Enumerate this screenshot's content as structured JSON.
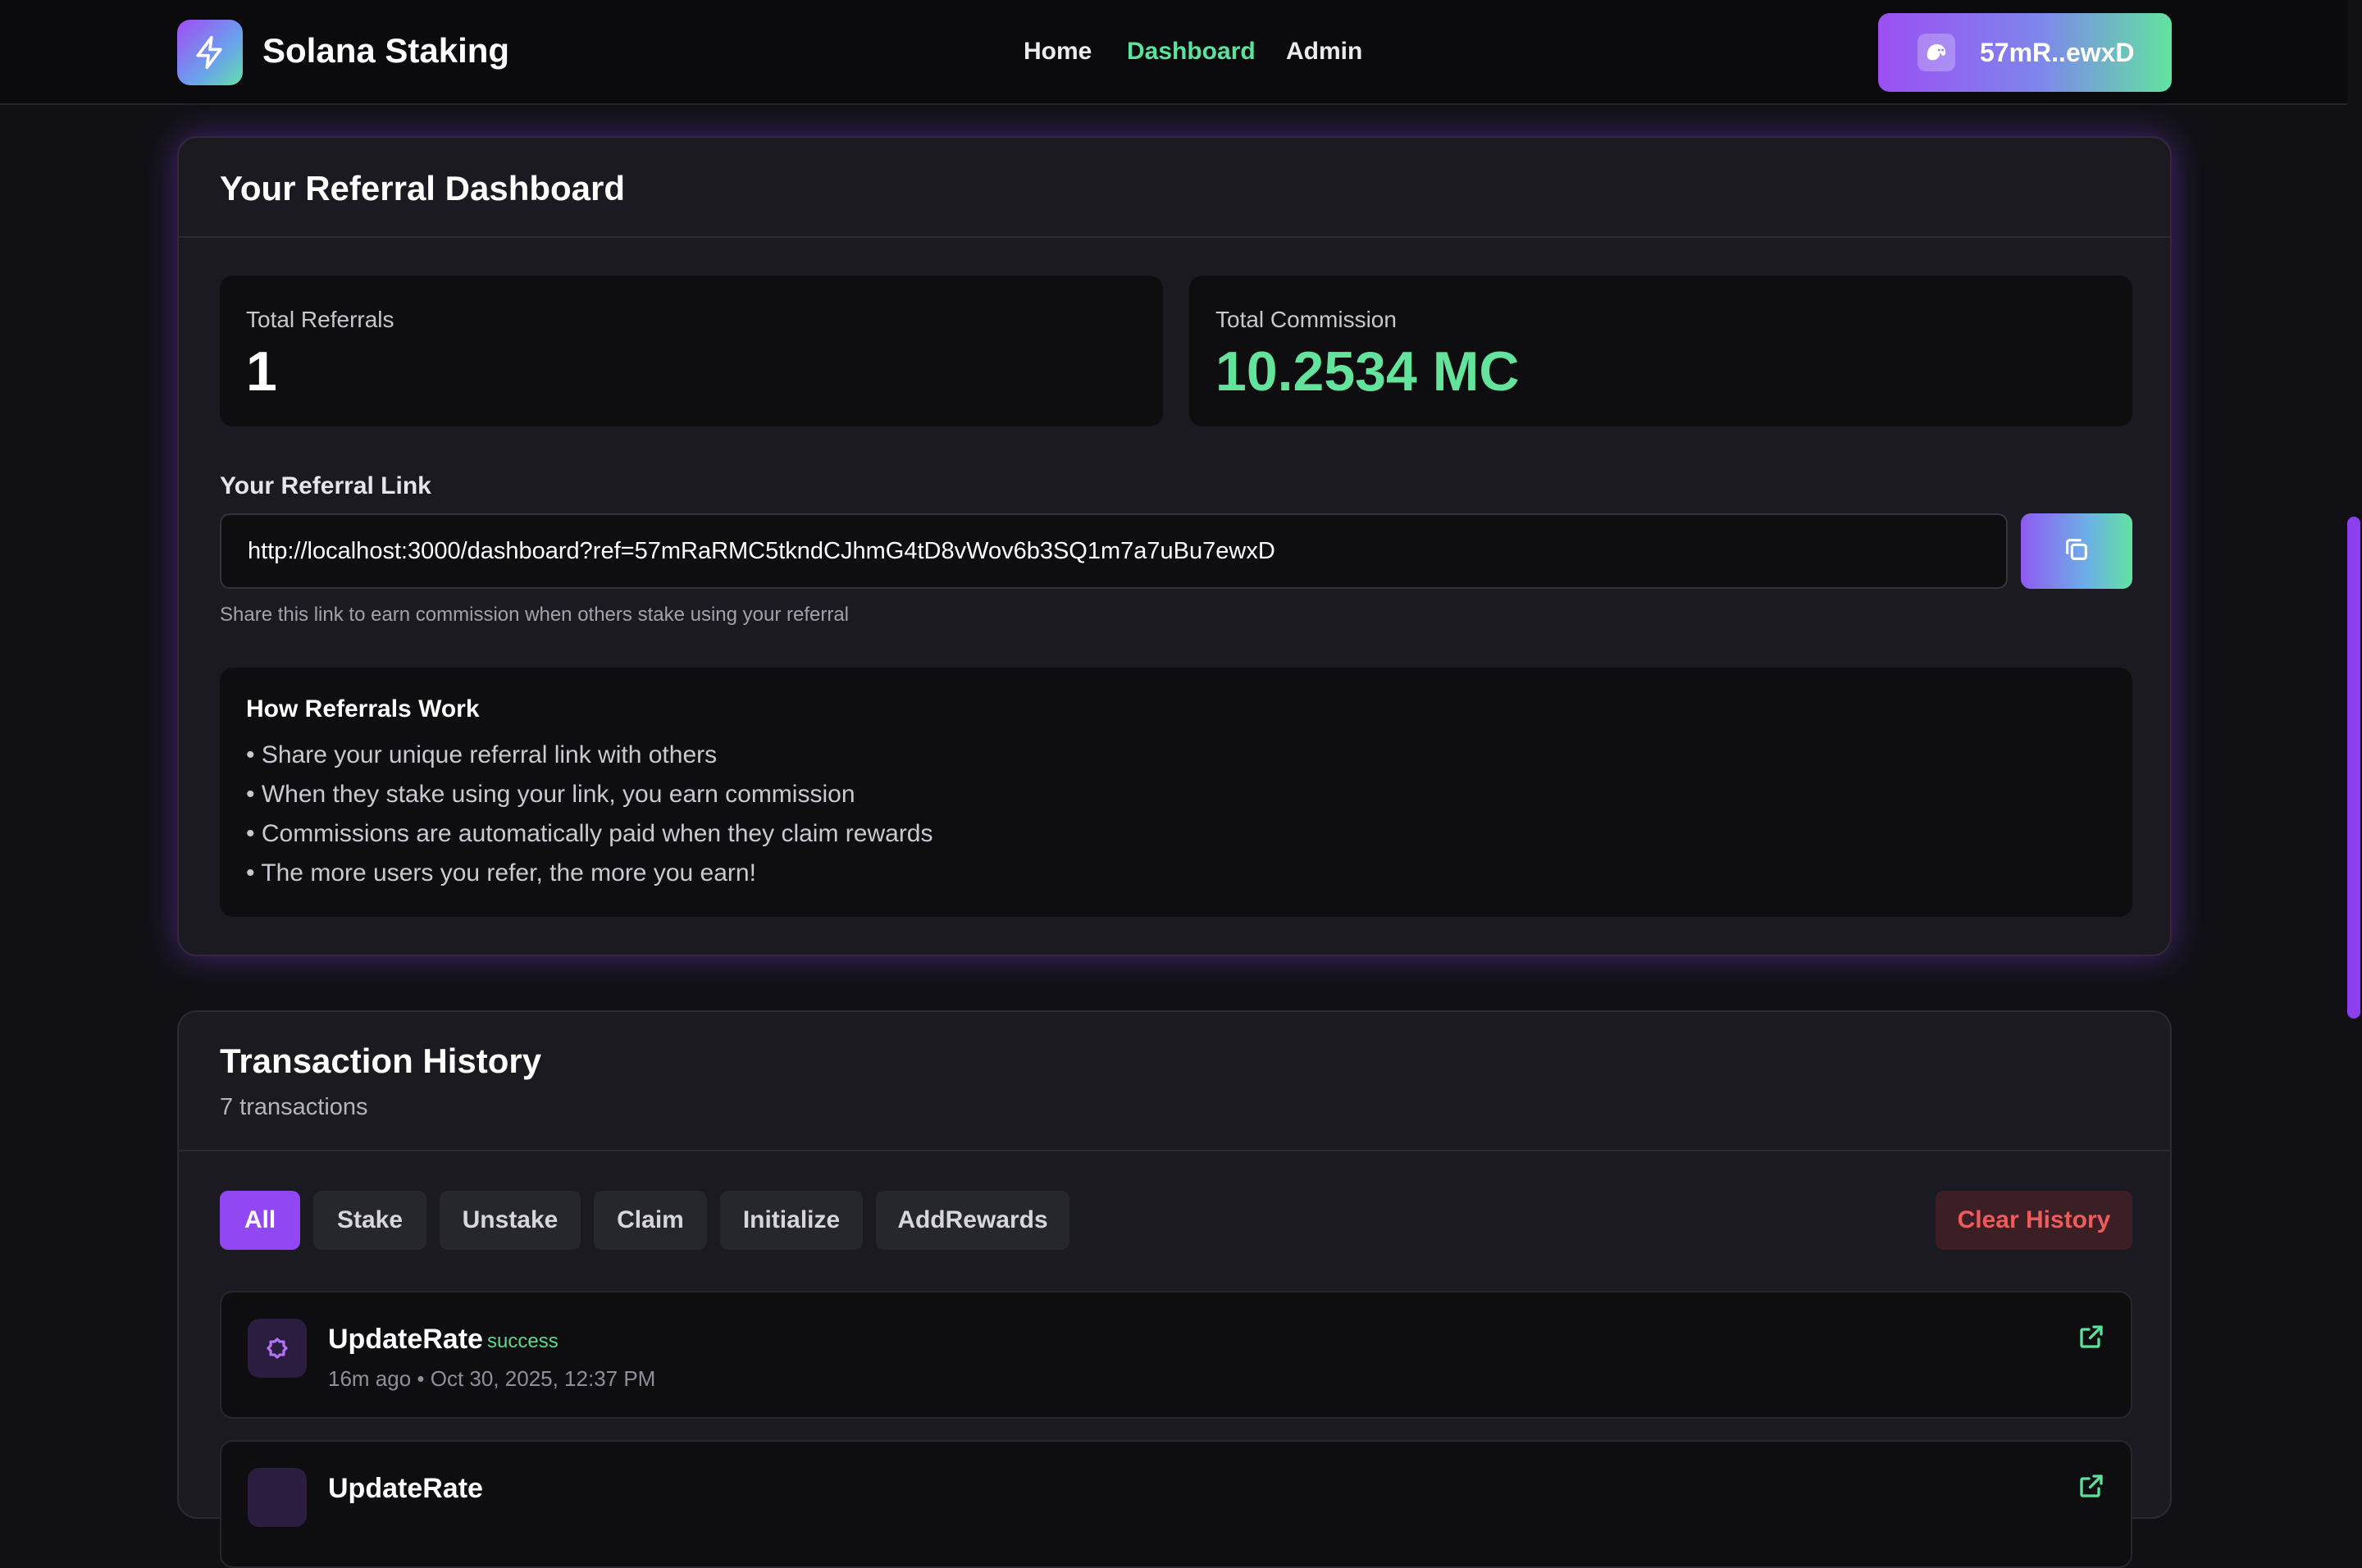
{
  "header": {
    "brand": "Solana Staking",
    "nav": [
      {
        "label": "Home",
        "active": false
      },
      {
        "label": "Dashboard",
        "active": true
      },
      {
        "label": "Admin",
        "active": false
      }
    ],
    "wallet_label": "57mR..ewxD",
    "logo_icon": "lightning-bolt-icon",
    "wallet_icon": "phantom-ghost-icon"
  },
  "referral": {
    "title": "Your Referral Dashboard",
    "total_referrals_label": "Total Referrals",
    "total_referrals_value": "1",
    "total_commission_label": "Total Commission",
    "total_commission_value": "10.2534 MC",
    "link_label": "Your Referral Link",
    "link_value": "http://localhost:3000/dashboard?ref=57mRaRMC5tkndCJhmG4tD8vWov6b3SQ1m7a7uBu7ewxD",
    "copy_icon": "copy-icon",
    "help_text": "Share this link to earn commission when others stake using your referral",
    "how_title": "How Referrals Work",
    "how_items": [
      "• Share your unique referral link with others",
      "• When they stake using your link, you earn commission",
      "• Commissions are automatically paid when they claim rewards",
      "• The more users you refer, the more you earn!"
    ]
  },
  "history": {
    "title": "Transaction History",
    "count_text": "7 transactions",
    "filters": [
      "All",
      "Stake",
      "Unstake",
      "Claim",
      "Initialize",
      "AddRewards"
    ],
    "active_filter": "All",
    "clear_label": "Clear History",
    "transactions": [
      {
        "type": "UpdateRate",
        "status": "success",
        "time": "16m ago • Oct 30, 2025, 12:37 PM"
      },
      {
        "type": "UpdateRate",
        "status": "",
        "time": ""
      }
    ]
  },
  "colors": {
    "accent_purple": "#9148f2",
    "accent_green": "#63e39c",
    "danger": "#ef5b5b"
  }
}
